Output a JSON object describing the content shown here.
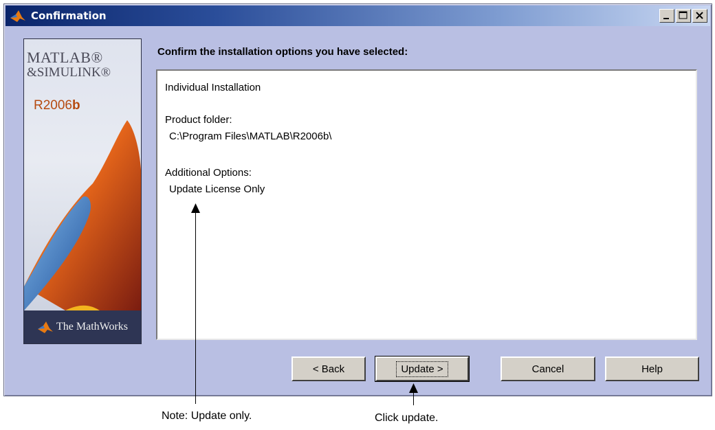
{
  "window": {
    "title": "Confirmation",
    "colors": {
      "background": "#b9bfe3",
      "titlebar_start": "#0a246a",
      "titlebar_end": "#c9d7f2"
    }
  },
  "brand": {
    "line1": "MATLAB®",
    "line2": "&SIMULINK®",
    "release_prefix": "R2006",
    "release_suffix": "b",
    "footer": "The MathWorks"
  },
  "heading": "Confirm the installation options you have selected:",
  "summary": {
    "install_type": "Individual Installation",
    "product_folder_label": "Product folder:",
    "product_folder_value": "C:\\Program Files\\MATLAB\\R2006b\\",
    "additional_options_label": "Additional Options:",
    "additional_options_value": "Update License Only"
  },
  "buttons": {
    "back": "< Back",
    "update": "Update >",
    "cancel": "Cancel",
    "help": "Help"
  },
  "annotations": {
    "note_update_only": "Note: Update only.",
    "click_update": "Click update."
  }
}
